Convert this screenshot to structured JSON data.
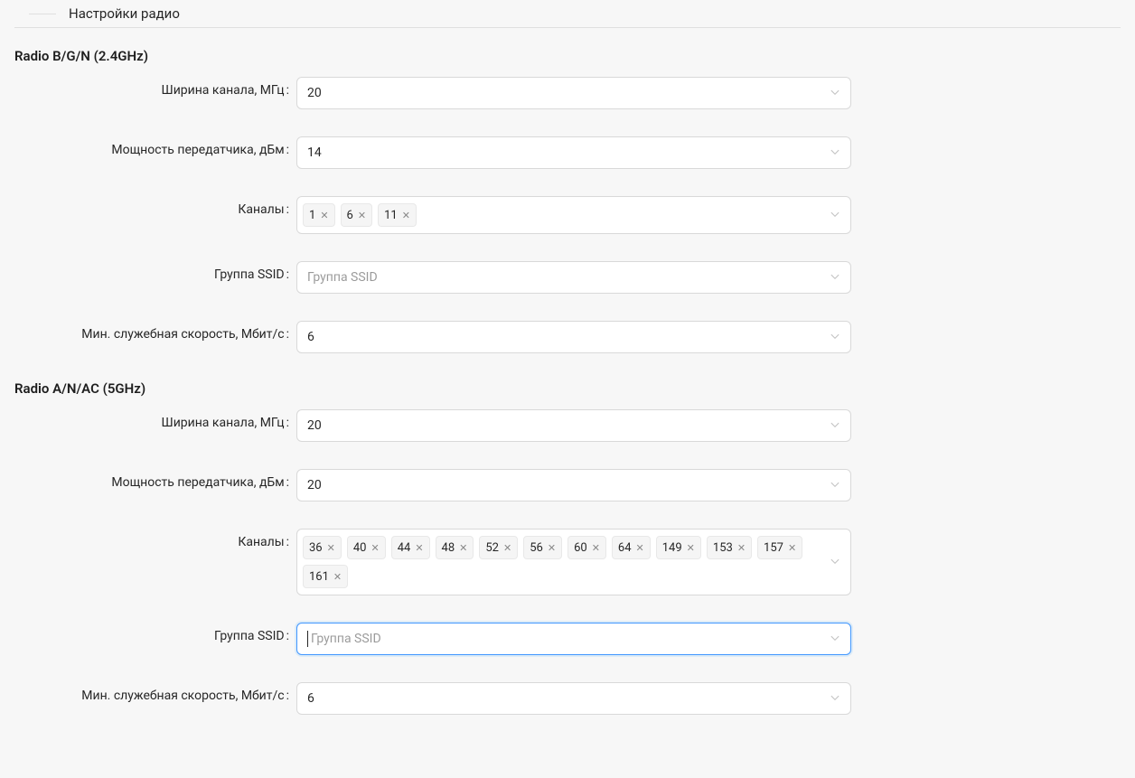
{
  "fieldset": {
    "title": "Настройки радио"
  },
  "radio24": {
    "header": "Radio B/G/N (2.4GHz)",
    "channel_width": {
      "label": "Ширина канала, МГц",
      "value": "20"
    },
    "tx_power": {
      "label": "Мощность передатчика, дБм",
      "value": "14"
    },
    "channels": {
      "label": "Каналы",
      "tags": [
        "1",
        "6",
        "11"
      ]
    },
    "ssid_group": {
      "label": "Группа SSID",
      "placeholder": "Группа SSID"
    },
    "min_rate": {
      "label": "Мин. служебная скорость, Мбит/с",
      "value": "6"
    }
  },
  "radio5": {
    "header": "Radio A/N/AC (5GHz)",
    "channel_width": {
      "label": "Ширина канала, МГц",
      "value": "20"
    },
    "tx_power": {
      "label": "Мощность передатчика, дБм",
      "value": "20"
    },
    "channels": {
      "label": "Каналы",
      "tags": [
        "36",
        "40",
        "44",
        "48",
        "52",
        "56",
        "60",
        "64",
        "149",
        "153",
        "157",
        "161"
      ]
    },
    "ssid_group": {
      "label": "Группа SSID",
      "placeholder": "Группа SSID",
      "focused": true
    },
    "min_rate": {
      "label": "Мин. служебная скорость, Мбит/с",
      "value": "6"
    }
  }
}
